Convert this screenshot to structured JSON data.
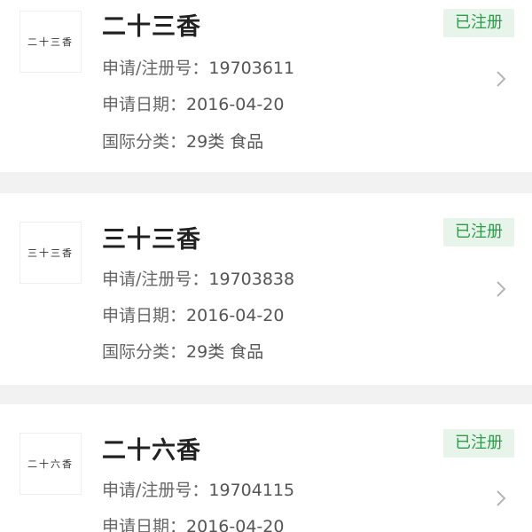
{
  "field_labels": {
    "reg_no": "申请/注册号：",
    "date": "申请日期：",
    "class": "国际分类："
  },
  "trademarks": [
    {
      "logo_text": "二十三香",
      "name": "二十三香",
      "status": "已注册",
      "reg_no": "19703611",
      "date": "2016-04-20",
      "class": "29类 食品"
    },
    {
      "logo_text": "三十三香",
      "name": "三十三香",
      "status": "已注册",
      "reg_no": "19703838",
      "date": "2016-04-20",
      "class": "29类 食品"
    },
    {
      "logo_text": "二十六香",
      "name": "二十六香",
      "status": "已注册",
      "reg_no": "19704115",
      "date": "2016-04-20"
    }
  ],
  "icons": {
    "chevron": "chevron-right-icon"
  },
  "colors": {
    "status_text": "#2f9a4b",
    "status_bg": "#e6f4ea",
    "separator": "#f2f2f2"
  }
}
